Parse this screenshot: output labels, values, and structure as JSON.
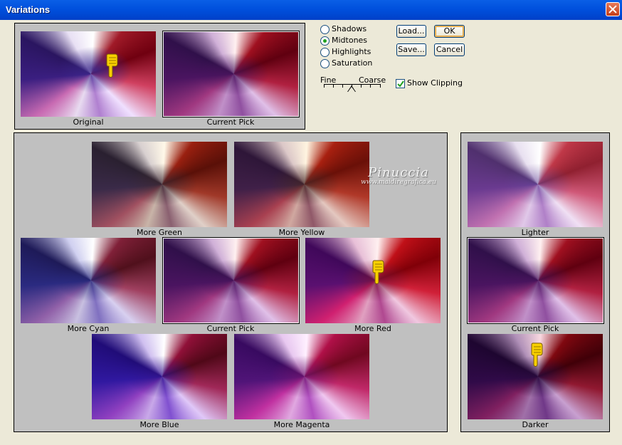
{
  "window": {
    "title": "Variations"
  },
  "tone_options": [
    {
      "label": "Shadows",
      "selected": false
    },
    {
      "label": "Midtones",
      "selected": true
    },
    {
      "label": "Highlights",
      "selected": false
    },
    {
      "label": "Saturation",
      "selected": false
    }
  ],
  "buttons": {
    "load": "Load...",
    "ok": "OK",
    "save": "Save...",
    "cancel": "Cancel"
  },
  "scale": {
    "fine": "Fine",
    "coarse": "Coarse"
  },
  "show_clipping": {
    "label": "Show Clipping",
    "checked": true
  },
  "preview": {
    "original": "Original",
    "current_pick": "Current Pick"
  },
  "color_variations": {
    "more_green": "More Green",
    "more_yellow": "More Yellow",
    "more_cyan": "More Cyan",
    "current_pick": "Current Pick",
    "more_red": "More Red",
    "more_blue": "More Blue",
    "more_magenta": "More Magenta"
  },
  "brightness": {
    "lighter": "Lighter",
    "current_pick": "Current Pick",
    "darker": "Darker"
  },
  "watermark": {
    "title": "Pinuccia",
    "url": "www.maidiregrafica.eu"
  }
}
